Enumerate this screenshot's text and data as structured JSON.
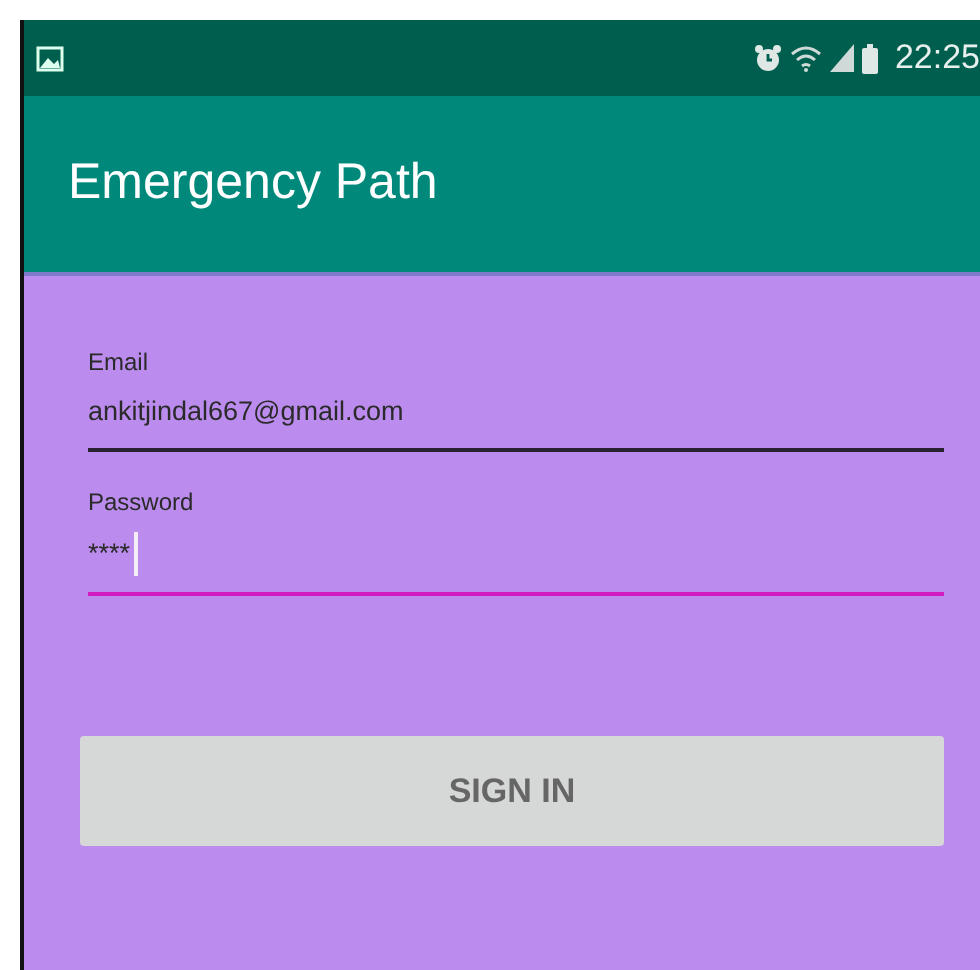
{
  "status_bar": {
    "time": "22:25"
  },
  "app_bar": {
    "title": "Emergency Path"
  },
  "fields": [
    {
      "label": "Email",
      "value": "ankitjindal667@gmail.com",
      "focused": false
    },
    {
      "label": "Password",
      "value": "****",
      "focused": true
    }
  ],
  "buttons": [
    "SIGN IN"
  ]
}
